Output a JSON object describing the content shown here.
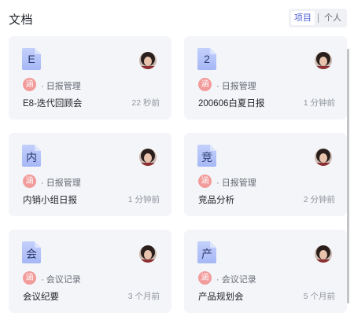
{
  "header": {
    "title": "文档",
    "tabs": [
      {
        "label": "项目",
        "active": true
      },
      {
        "label": "个人",
        "active": false
      }
    ]
  },
  "cards": [
    {
      "icon_char": "E",
      "tag": "涵",
      "category": "日报管理",
      "name": "E8-迭代回顾会",
      "time": "22 秒前"
    },
    {
      "icon_char": "2",
      "tag": "涵",
      "category": "日报管理",
      "name": "200606白夏日报",
      "time": "1 分钟前"
    },
    {
      "icon_char": "内",
      "tag": "涵",
      "category": "日报管理",
      "name": "内销小组日报",
      "time": "1 分钟前"
    },
    {
      "icon_char": "竞",
      "tag": "涵",
      "category": "日报管理",
      "name": "竞品分析",
      "time": "2 分钟前"
    },
    {
      "icon_char": "会",
      "tag": "涵",
      "category": "会议记录",
      "name": "会议纪要",
      "time": "3 个月前"
    },
    {
      "icon_char": "产",
      "tag": "涵",
      "category": "会议记录",
      "name": "产品规划会",
      "time": "5 个月前"
    }
  ],
  "colors": {
    "accent": "#4e5fd0",
    "card_bg": "#f4f5f8",
    "tag_bg": "#f29b9b",
    "doc_icon": "#a9bdf9"
  }
}
